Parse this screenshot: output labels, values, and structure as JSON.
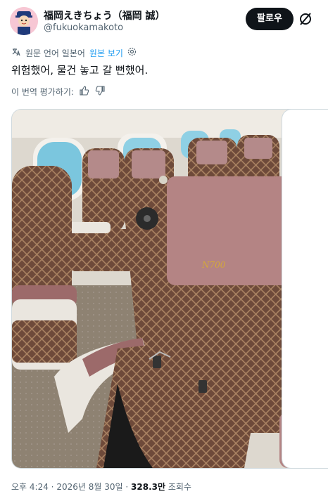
{
  "author": {
    "display_name": "福岡えきちょう（福岡 誠）",
    "handle": "@fukuokamakoto"
  },
  "follow_label": "팔로우",
  "translate": {
    "info": "원문 언어 일본어",
    "show_original": "원본 보기"
  },
  "tweet_text": "위험했어, 물건 놓고 갈 뻔했어.",
  "rate_translation": "이 번역 평가하기:",
  "meta": {
    "time": "오후 4:24",
    "sep1": "·",
    "date": "2026년 8월 30일",
    "sep2": "·",
    "views_count": "328.3만",
    "views_label": "조회수"
  },
  "photo": {
    "headrest_logo": "N700"
  }
}
